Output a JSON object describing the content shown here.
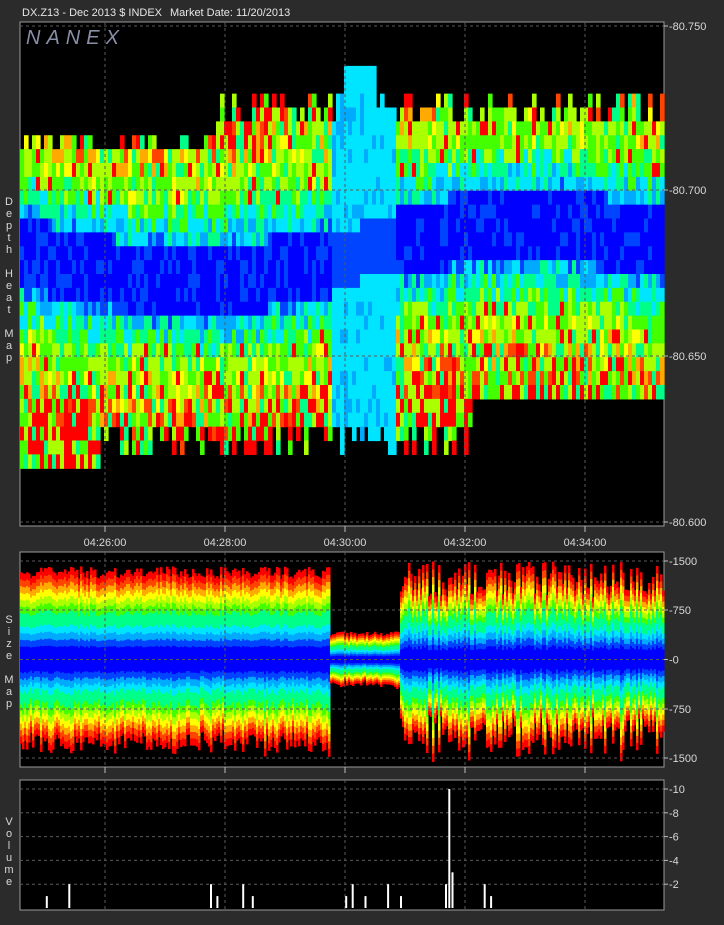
{
  "header": {
    "symbol": "DX.Z13 - Dec 2013 $ INDEX",
    "market_date": "Market Date: 11/20/2013",
    "logo": "NANEX"
  },
  "panel_labels": {
    "depth": "Depth Heat Map",
    "size": "Size Map",
    "volume": "Volume"
  },
  "colors": {
    "background": "#2b2b2b",
    "plot": "#000000",
    "ramp": [
      "#0000ff",
      "#0044ff",
      "#00aaff",
      "#00e5ff",
      "#00ff88",
      "#44ff00",
      "#aaff00",
      "#ffff00",
      "#ffaa00",
      "#ff4400",
      "#ff0000"
    ]
  },
  "chart_data": [
    {
      "type": "heatmap",
      "name_printed": "Depth Heat Map",
      "x_ticks": [
        "04:26:00",
        "04:28:00",
        "04:30:00",
        "04:32:00",
        "04:34:00"
      ],
      "x_range": [
        "04:25:15",
        "04:35:15"
      ],
      "y_ticks": [
        "-80.750",
        "-80.700",
        "-80.650",
        "-80.600"
      ],
      "ylim": [
        80.6,
        80.75
      ],
      "grid": true
    },
    {
      "type": "area",
      "name_printed": "Size Map",
      "y_ticks": [
        "-1500",
        "-750",
        "-0",
        "-750",
        "-1500"
      ],
      "ylim": [
        -1500,
        1500
      ],
      "grid": true
    },
    {
      "type": "bar",
      "name_printed": "Volume",
      "y_ticks": [
        "-10",
        "-8",
        "-6",
        "-4",
        "-2"
      ],
      "ylim": [
        0,
        10
      ],
      "grid": true,
      "bars": [
        {
          "t": 0.04,
          "v": 1
        },
        {
          "t": 0.075,
          "v": 2
        },
        {
          "t": 0.295,
          "v": 2
        },
        {
          "t": 0.305,
          "v": 1
        },
        {
          "t": 0.345,
          "v": 2
        },
        {
          "t": 0.36,
          "v": 1
        },
        {
          "t": 0.505,
          "v": 1
        },
        {
          "t": 0.515,
          "v": 2
        },
        {
          "t": 0.535,
          "v": 1
        },
        {
          "t": 0.57,
          "v": 2
        },
        {
          "t": 0.59,
          "v": 1
        },
        {
          "t": 0.66,
          "v": 2
        },
        {
          "t": 0.665,
          "v": 10
        },
        {
          "t": 0.67,
          "v": 3
        },
        {
          "t": 0.72,
          "v": 2
        },
        {
          "t": 0.73,
          "v": 1
        }
      ]
    }
  ]
}
